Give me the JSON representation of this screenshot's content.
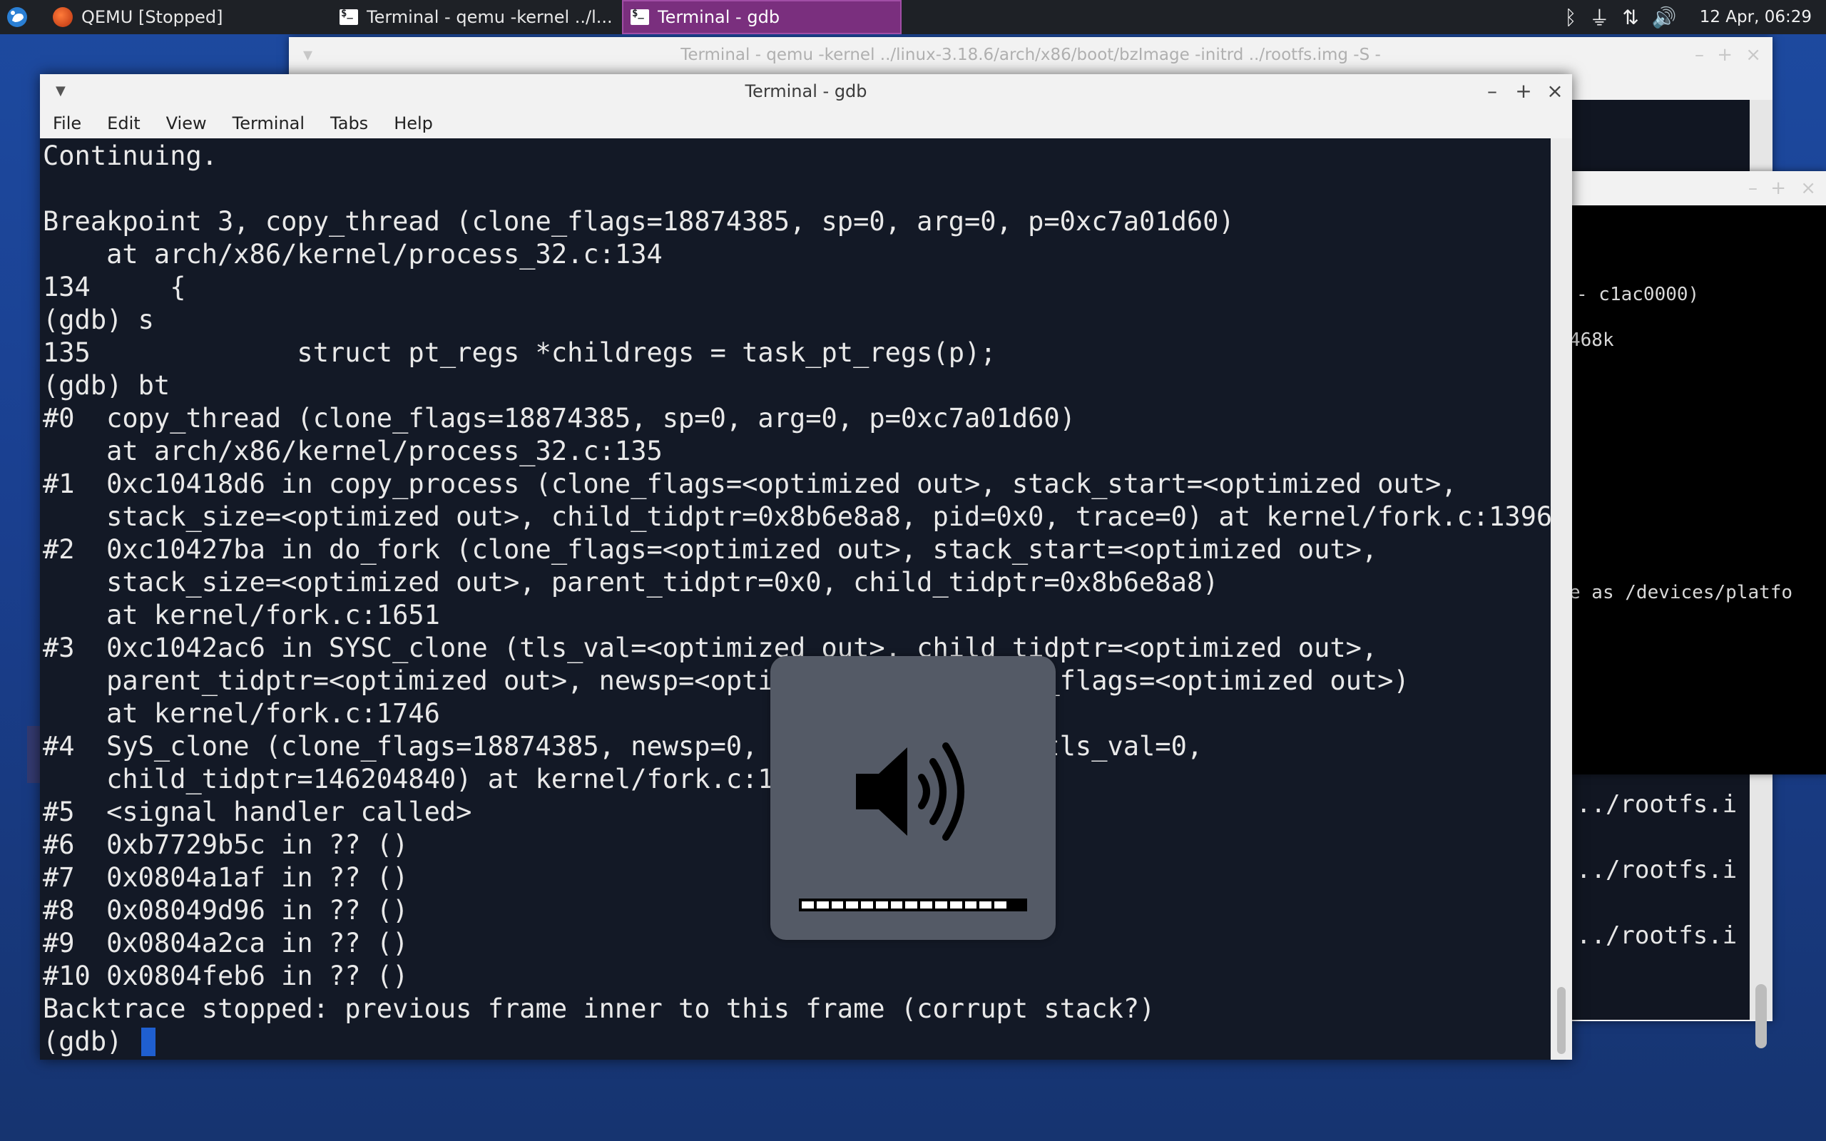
{
  "taskbar": {
    "tasks": [
      {
        "label": "QEMU [Stopped]",
        "icon": "qemu-icon"
      },
      {
        "label": "Terminal - qemu -kernel ../l...",
        "icon": "terminal-icon"
      },
      {
        "label": "Terminal - gdb",
        "icon": "terminal-icon",
        "active": true
      }
    ],
    "tray_icons": [
      "bluetooth-icon",
      "power-plug-icon",
      "network-icon",
      "volume-icon"
    ],
    "clock": "12 Apr, 06:29"
  },
  "qemu_terminal_window": {
    "title": "Terminal - qemu -kernel ../linux-3.18.6/arch/x86/boot/bzImage -initrd ../rootfs.img -S -",
    "visible_lines": [
      "../rootfs.i",
      "../rootfs.i",
      "../rootfs.i"
    ]
  },
  "qemu_vm_window": {
    "visible_lines": [
      "- c1ac0000)",
      "468k",
      "e as /devices/platfo"
    ]
  },
  "gdb_window": {
    "title": "Terminal - gdb",
    "menu": [
      "File",
      "Edit",
      "View",
      "Terminal",
      "Tabs",
      "Help"
    ],
    "lines": [
      "Continuing.",
      "",
      "Breakpoint 3, copy_thread (clone_flags=18874385, sp=0, arg=0, p=0xc7a01d60)",
      "    at arch/x86/kernel/process_32.c:134",
      "134     {",
      "(gdb) s",
      "135             struct pt_regs *childregs = task_pt_regs(p);",
      "(gdb) bt",
      "#0  copy_thread (clone_flags=18874385, sp=0, arg=0, p=0xc7a01d60)",
      "    at arch/x86/kernel/process_32.c:135",
      "#1  0xc10418d6 in copy_process (clone_flags=<optimized out>, stack_start=<optimized out>,",
      "    stack_size=<optimized out>, child_tidptr=0x8b6e8a8, pid=0x0, trace=0) at kernel/fork.c:1396",
      "#2  0xc10427ba in do_fork (clone_flags=<optimized out>, stack_start=<optimized out>,",
      "    stack_size=<optimized out>, parent_tidptr=0x0, child_tidptr=0x8b6e8a8)",
      "    at kernel/fork.c:1651",
      "#3  0xc1042ac6 in SYSC_clone (tls_val=<optimized out>, child_tidptr=<optimized out>,",
      "    parent_tidptr=<optimized out>, newsp=<optimized out>, clone_flags=<optimized out>)",
      "    at kernel/fork.c:1746",
      "#4  SyS_clone (clone_flags=18874385, newsp=0, parent_tidptr=0, tls_val=0,",
      "    child_tidptr=146204840) at kernel/fork.c:1740",
      "#5  <signal handler called>",
      "#6  0xb7729b5c in ?? ()",
      "#7  0x0804a1af in ?? ()",
      "#8  0x08049d96 in ?? ()",
      "#9  0x0804a2ca in ?? ()",
      "#10 0x0804feb6 in ?? ()",
      "Backtrace stopped: previous frame inner to this frame (corrupt stack?)"
    ],
    "prompt": "(gdb) "
  },
  "volume_osd": {
    "icon": "speaker-volume-high-icon",
    "level": 0.92,
    "segments": 14
  },
  "colors": {
    "terminal_bg": "#131926",
    "active_task": "#7a2f7e",
    "cursor": "#1f5fd0"
  }
}
